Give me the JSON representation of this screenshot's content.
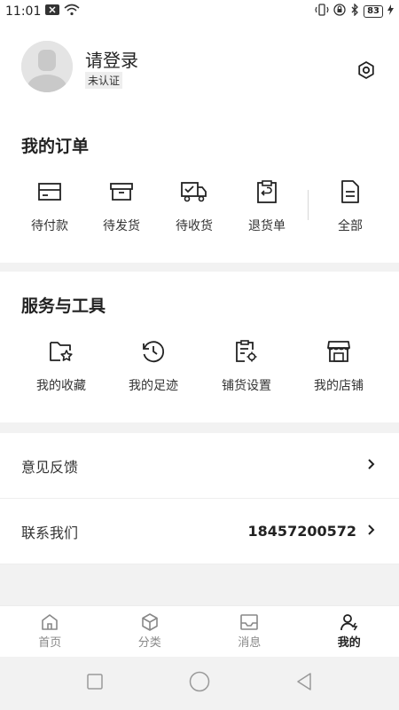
{
  "status_bar": {
    "time": "11:01",
    "battery": "83"
  },
  "profile": {
    "login_text": "请登录",
    "badge": "未认证"
  },
  "orders": {
    "title": "我的订单",
    "items": [
      {
        "label": "待付款",
        "icon": "wallet-card-icon"
      },
      {
        "label": "待发货",
        "icon": "box-icon"
      },
      {
        "label": "待收货",
        "icon": "truck-icon"
      },
      {
        "label": "退货单",
        "icon": "return-clipboard-icon"
      },
      {
        "label": "全部",
        "icon": "document-icon"
      }
    ]
  },
  "tools": {
    "title": "服务与工具",
    "items": [
      {
        "label": "我的收藏",
        "icon": "folder-star-icon"
      },
      {
        "label": "我的足迹",
        "icon": "history-clock-icon"
      },
      {
        "label": "铺货设置",
        "icon": "clipboard-settings-icon"
      },
      {
        "label": "我的店铺",
        "icon": "store-icon"
      }
    ]
  },
  "list": {
    "feedback": "意见反馈",
    "contact": "联系我们",
    "phone": "18457200572"
  },
  "tabbar": {
    "tabs": [
      {
        "label": "首页",
        "icon": "home-icon",
        "active": false
      },
      {
        "label": "分类",
        "icon": "cube-icon",
        "active": false
      },
      {
        "label": "消息",
        "icon": "inbox-icon",
        "active": false
      },
      {
        "label": "我的",
        "icon": "user-icon",
        "active": true
      }
    ]
  }
}
